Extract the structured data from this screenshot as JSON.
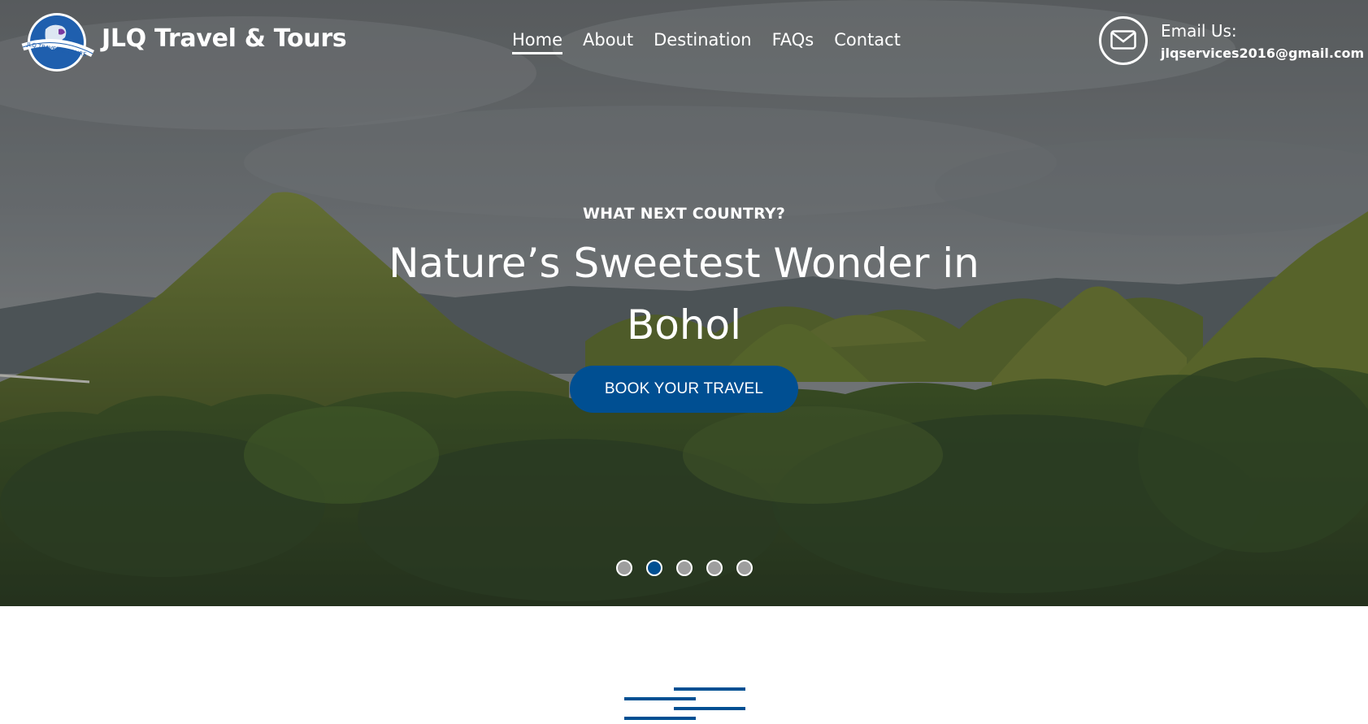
{
  "header": {
    "brand_name": "JLQ Travel & Tours",
    "logo_text": "JLQ TRAVEL & TOURS",
    "nav": [
      {
        "label": "Home",
        "active": true
      },
      {
        "label": "About",
        "active": false
      },
      {
        "label": "Destination",
        "active": false
      },
      {
        "label": "FAQs",
        "active": false
      },
      {
        "label": "Contact",
        "active": false
      }
    ],
    "email_label": "Email Us:",
    "email_value": "jlqservices2016@gmail.com",
    "email_icon": "envelope-icon"
  },
  "hero": {
    "eyebrow": "WHAT NEXT COUNTRY?",
    "headline": "Nature’s Sweetest Wonder in Bohol",
    "cta_label": "BOOK YOUR TRAVEL",
    "slide_count": 5,
    "active_slide": 2
  },
  "colors": {
    "accent": "#004f92",
    "text_light": "#ffffff",
    "dot_inactive": "#9e9e9e"
  },
  "section": {
    "divider_icon": "decorative-lines-icon"
  }
}
